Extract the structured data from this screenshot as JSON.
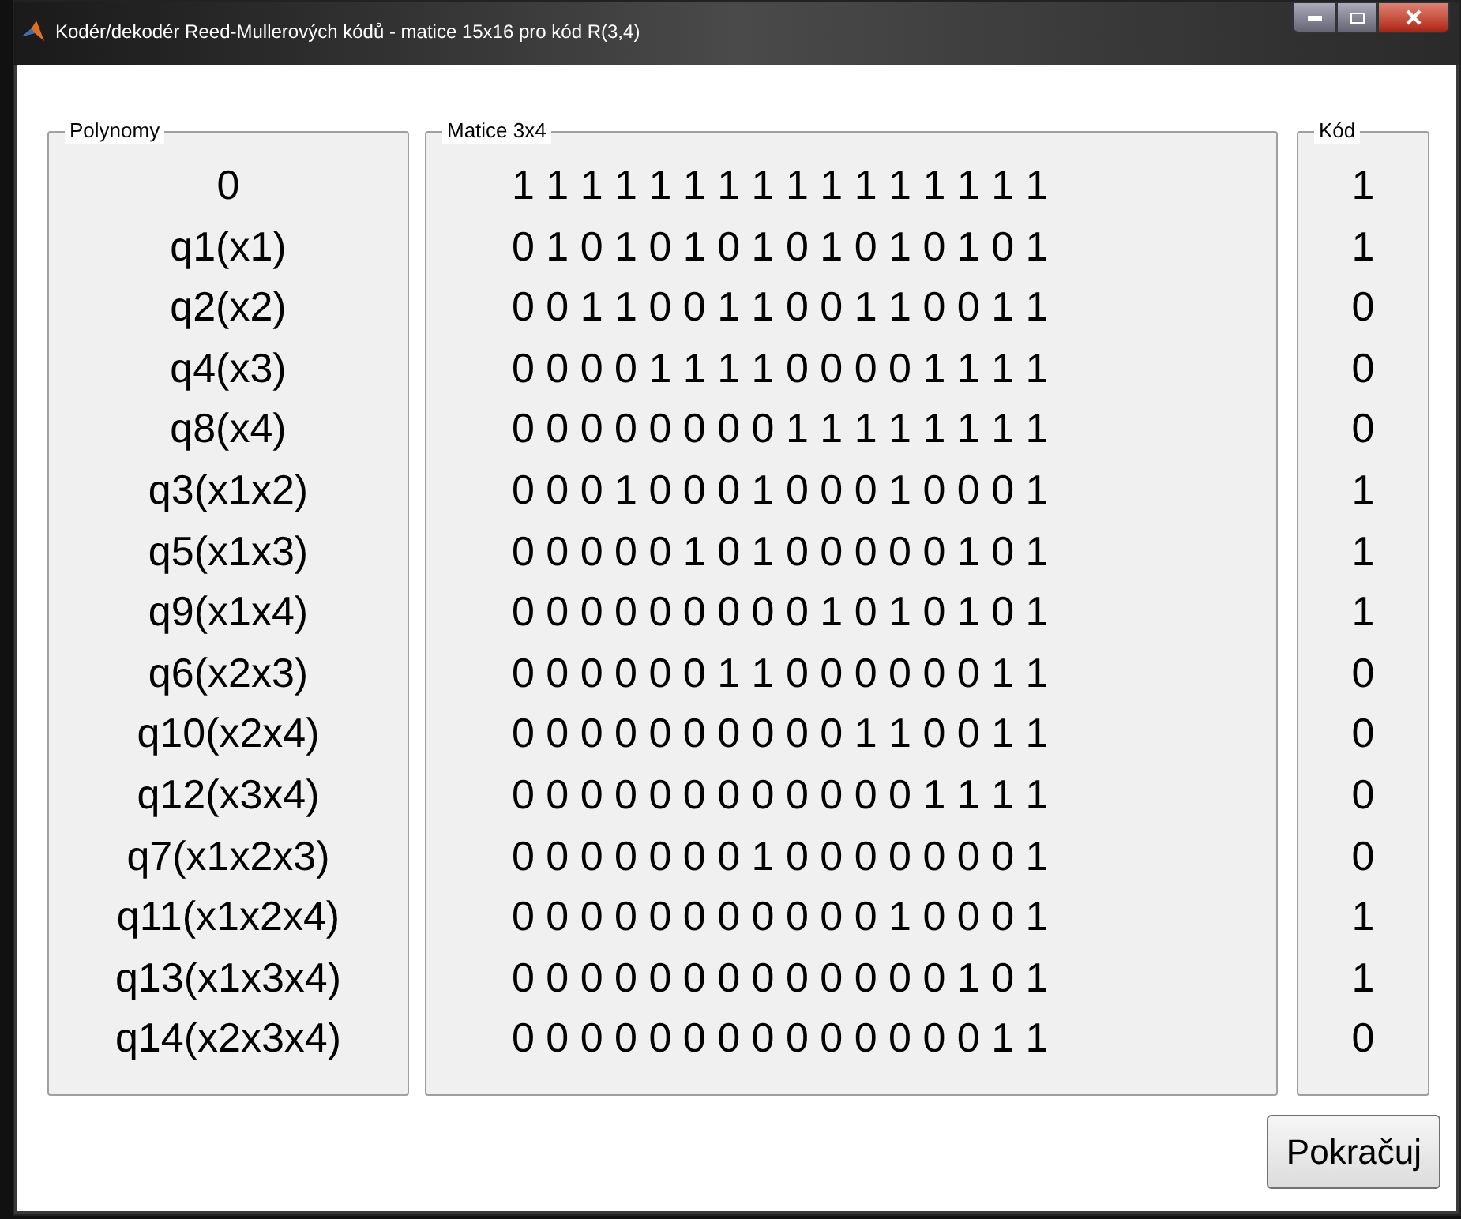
{
  "window": {
    "title": "Kodér/dekodér Reed-Mullerových kódů - matice 15x16 pro kód R(3,4)"
  },
  "panels": {
    "polynomy": {
      "title": "Polynomy",
      "items": [
        "0",
        "q1(x1)",
        "q2(x2)",
        "q4(x3)",
        "q8(x4)",
        "q3(x1x2)",
        "q5(x1x3)",
        "q9(x1x4)",
        "q6(x2x3)",
        "q10(x2x4)",
        "q12(x3x4)",
        "q7(x1x2x3)",
        "q11(x1x2x4)",
        "q13(x1x3x4)",
        "q14(x2x3x4)"
      ]
    },
    "matice": {
      "title": "Matice 3x4",
      "rows": [
        "1 1 1 1 1 1 1 1 1 1 1 1 1 1 1 1",
        "0 1 0 1 0 1 0 1 0 1 0 1 0 1 0 1",
        "0 0 1 1 0 0 1 1 0 0 1 1 0 0 1 1",
        "0 0 0 0 1 1 1 1 0 0 0 0 1 1 1 1",
        "0 0 0 0 0 0 0 0 1 1 1 1 1 1 1 1",
        "0 0 0 1 0 0 0 1 0 0 0 1 0 0 0 1",
        "0 0 0 0 0 1 0 1 0 0 0 0 0 1 0 1",
        "0 0 0 0 0 0 0 0 0 1 0 1 0 1 0 1",
        "0 0 0 0 0 0 1 1 0 0 0 0 0 0 1 1",
        "0 0 0 0 0 0 0 0 0 0 1 1 0 0 1 1",
        "0 0 0 0 0 0 0 0 0 0 0 0 1 1 1 1",
        "0 0 0 0 0 0 0 1 0 0 0 0 0 0 0 1",
        "0 0 0 0 0 0 0 0 0 0 0 1 0 0 0 1",
        "0 0 0 0 0 0 0 0 0 0 0 0 0 1 0 1",
        "0 0 0 0 0 0 0 0 0 0 0 0 0 0 1 1"
      ]
    },
    "kod": {
      "title": "Kód",
      "items": [
        "1",
        "1",
        "0",
        "0",
        "0",
        "1",
        "1",
        "1",
        "0",
        "0",
        "0",
        "0",
        "1",
        "1",
        "0"
      ]
    }
  },
  "buttons": [
    "Pokračuj"
  ]
}
